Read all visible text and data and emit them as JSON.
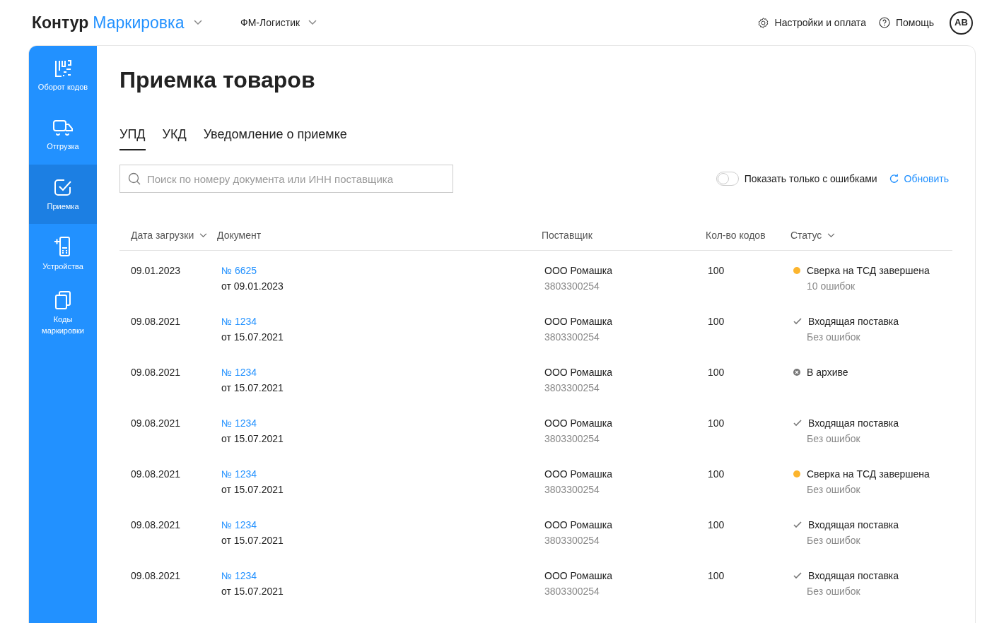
{
  "header": {
    "logo_brand": "Контур",
    "logo_product": "Маркировка",
    "organization": "ФМ-Логистик",
    "settings": "Настройки и оплата",
    "help": "Помощь",
    "avatar": "AB"
  },
  "sidebar": {
    "items": [
      {
        "kind": "codes",
        "label": "Оборот кодов",
        "selected": false
      },
      {
        "kind": "shipping",
        "label": "Отгрузка",
        "selected": false
      },
      {
        "kind": "receiving",
        "label": "Приемка",
        "selected": true
      },
      {
        "kind": "devices",
        "label": "Устройства",
        "selected": false
      },
      {
        "kind": "marks",
        "label": "Коды маркировки",
        "selected": false
      }
    ]
  },
  "page": {
    "title": "Приемка товаров"
  },
  "tabs": [
    {
      "label": "УПД",
      "selected": true
    },
    {
      "label": "УКД",
      "selected": false
    },
    {
      "label": "Уведомление о приемке",
      "selected": false
    }
  ],
  "search": {
    "placeholder": "Поиск по номеру документа или ИНН поставщика"
  },
  "errors_toggle": {
    "label": "Показать только с ошибками",
    "on": false
  },
  "refresh": "Обновить",
  "table": {
    "columns": [
      {
        "label": "Дата загрузки",
        "sortable": true
      },
      {
        "label": "Документ",
        "sortable": false
      },
      {
        "label": "Поставщик",
        "sortable": false
      },
      {
        "label": "Кол-во кодов",
        "sortable": false
      },
      {
        "label": "Статус",
        "sortable": true
      }
    ],
    "rows": [
      {
        "date": "09.01.2023",
        "doc_number": "№ 6625",
        "doc_date": "от 09.01.2023",
        "supplier": "ООО Ромашка",
        "inn": "3803300254",
        "count": "100",
        "status": {
          "kind": "dot",
          "color": "#fcb52d",
          "label": "Сверка на ТСД завершена",
          "note": "10 ошибок"
        }
      },
      {
        "date": "09.08.2021",
        "doc_number": "№ 1234",
        "doc_date": "от 15.07.2021",
        "supplier": "ООО Ромашка",
        "inn": "3803300254",
        "count": "100",
        "status": {
          "kind": "incoming",
          "label": "Входящая поставка",
          "note": "Без ошибок"
        }
      },
      {
        "date": "09.08.2021",
        "doc_number": "№ 1234",
        "doc_date": "от 15.07.2021",
        "supplier": "ООО Ромашка",
        "inn": "3803300254",
        "count": "100",
        "status": {
          "kind": "archive",
          "label": "В архиве"
        }
      },
      {
        "date": "09.08.2021",
        "doc_number": "№ 1234",
        "doc_date": "от 15.07.2021",
        "supplier": "ООО Ромашка",
        "inn": "3803300254",
        "count": "100",
        "status": {
          "kind": "incoming",
          "label": "Входящая поставка",
          "note": "Без ошибок"
        }
      },
      {
        "date": "09.08.2021",
        "doc_number": "№ 1234",
        "doc_date": "от 15.07.2021",
        "supplier": "ООО Ромашка",
        "inn": "3803300254",
        "count": "100",
        "status": {
          "kind": "dot",
          "color": "#fcb52d",
          "label": "Сверка на ТСД завершена",
          "note": "Без ошибок"
        }
      },
      {
        "date": "09.08.2021",
        "doc_number": "№ 1234",
        "doc_date": "от 15.07.2021",
        "supplier": "ООО Ромашка",
        "inn": "3803300254",
        "count": "100",
        "status": {
          "kind": "incoming",
          "label": "Входящая поставка",
          "note": "Без ошибок"
        }
      },
      {
        "date": "09.08.2021",
        "doc_number": "№ 1234",
        "doc_date": "от 15.07.2021",
        "supplier": "ООО Ромашка",
        "inn": "3803300254",
        "count": "100",
        "status": {
          "kind": "incoming",
          "label": "Входящая поставка",
          "note": "Без ошибок"
        }
      }
    ]
  }
}
